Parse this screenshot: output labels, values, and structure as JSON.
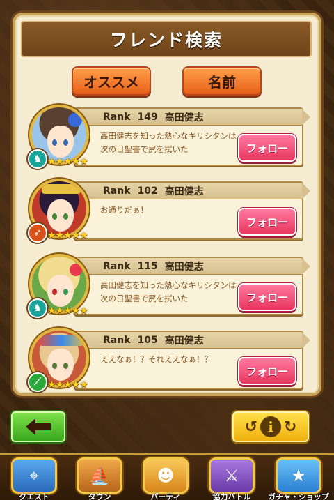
{
  "header": {
    "title": "フレンド検索"
  },
  "tabs": [
    {
      "label": "オススメ"
    },
    {
      "label": "名前"
    }
  ],
  "friends": [
    {
      "rank_label": "Rank",
      "rank": "149",
      "name": "高田健志",
      "message": "高田健志を知った熱心なキリシタンは次の日聖書で尻を拭いた",
      "follow_label": "フォロー",
      "class_icon": "pegasus-icon",
      "badge_color": "#1aa59a",
      "stars": "★★★★★"
    },
    {
      "rank_label": "Rank",
      "rank": "102",
      "name": "高田健志",
      "message": "お通りだぁ！",
      "follow_label": "フォロー",
      "class_icon": "bow-icon",
      "badge_color": "#d8501a",
      "stars": "★★★★★"
    },
    {
      "rank_label": "Rank",
      "rank": "115",
      "name": "高田健志",
      "message": "高田健志を知った熱心なキリシタンは次の日聖書で尻を拭いた",
      "follow_label": "フォロー",
      "class_icon": "pegasus-icon",
      "badge_color": "#1aa59a",
      "stars": "★★★★★"
    },
    {
      "rank_label": "Rank",
      "rank": "105",
      "name": "高田健志",
      "message": "ええなぁ！？それええなぁ！？",
      "follow_label": "フォロー",
      "class_icon": "spear-icon",
      "badge_color": "#2aa83a",
      "stars": "★★★★★"
    }
  ],
  "controls": {
    "back_icon": "left-arrow-icon",
    "info_left": "↺",
    "info_center": "i",
    "info_right": "↻"
  },
  "nav": [
    {
      "label": "クエスト",
      "icon": "map-icon",
      "color": "#3a8ad8"
    },
    {
      "label": "タウン",
      "icon": "ship-icon",
      "color": "#d88a2a"
    },
    {
      "label": "パーティ",
      "icon": "group-icon",
      "color": "#e8a83a"
    },
    {
      "label": "協力バトル",
      "icon": "shield-icon",
      "color": "#8a5ac8"
    },
    {
      "label": "ガチャ・ショップ",
      "icon": "star-icon",
      "color": "#3aa0e8"
    }
  ]
}
